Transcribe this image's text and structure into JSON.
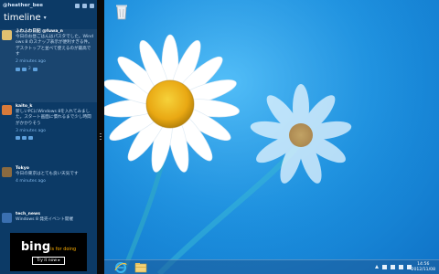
{
  "app": {
    "header": {
      "account": "@heather_bee"
    },
    "title": "timeline",
    "tweets": [
      {
        "name": "ふわふわ日記 @fuwa_n",
        "text": "今日のお昼ごはんはパスタでした。Windows 8 のスナップ表示が便利すぎる件。デスクトップと並べて使えるのが最高です",
        "time": "2 minutes ago",
        "avatar_color": "#e0c070",
        "count": "2"
      },
      {
        "name": "kaito_k",
        "text": "新しいPCにWindows 8を入れてみました。スタート画面に慣れるまで少し時間がかかりそう",
        "time": "3 minutes ago",
        "avatar_color": "#d87a3a",
        "count": ""
      },
      {
        "name": "Tokyo",
        "text": "今日の東京はとても良い天気です",
        "time": "4 minutes ago",
        "avatar_color": "#8a6a40",
        "count": ""
      },
      {
        "name": "tech_news",
        "text": "Windows 8 発売イベント開催",
        "time": "5 minutes ago",
        "avatar_color": "#3a6fb0",
        "count": ""
      }
    ],
    "ad": {
      "brand": "bing",
      "tagline": "is for doing",
      "button": "Try it now ▸"
    }
  },
  "taskbar": {
    "time": "14:56",
    "date": "2012/11/08"
  },
  "colors": {
    "app_bg": "#0c3a66",
    "desktop_bg": "#1e95e3",
    "flower_petal": "#ffffff",
    "flower_center": "#f2b619"
  },
  "icons": [
    "recycle-bin-icon",
    "internet-explorer-icon",
    "file-explorer-icon"
  ]
}
